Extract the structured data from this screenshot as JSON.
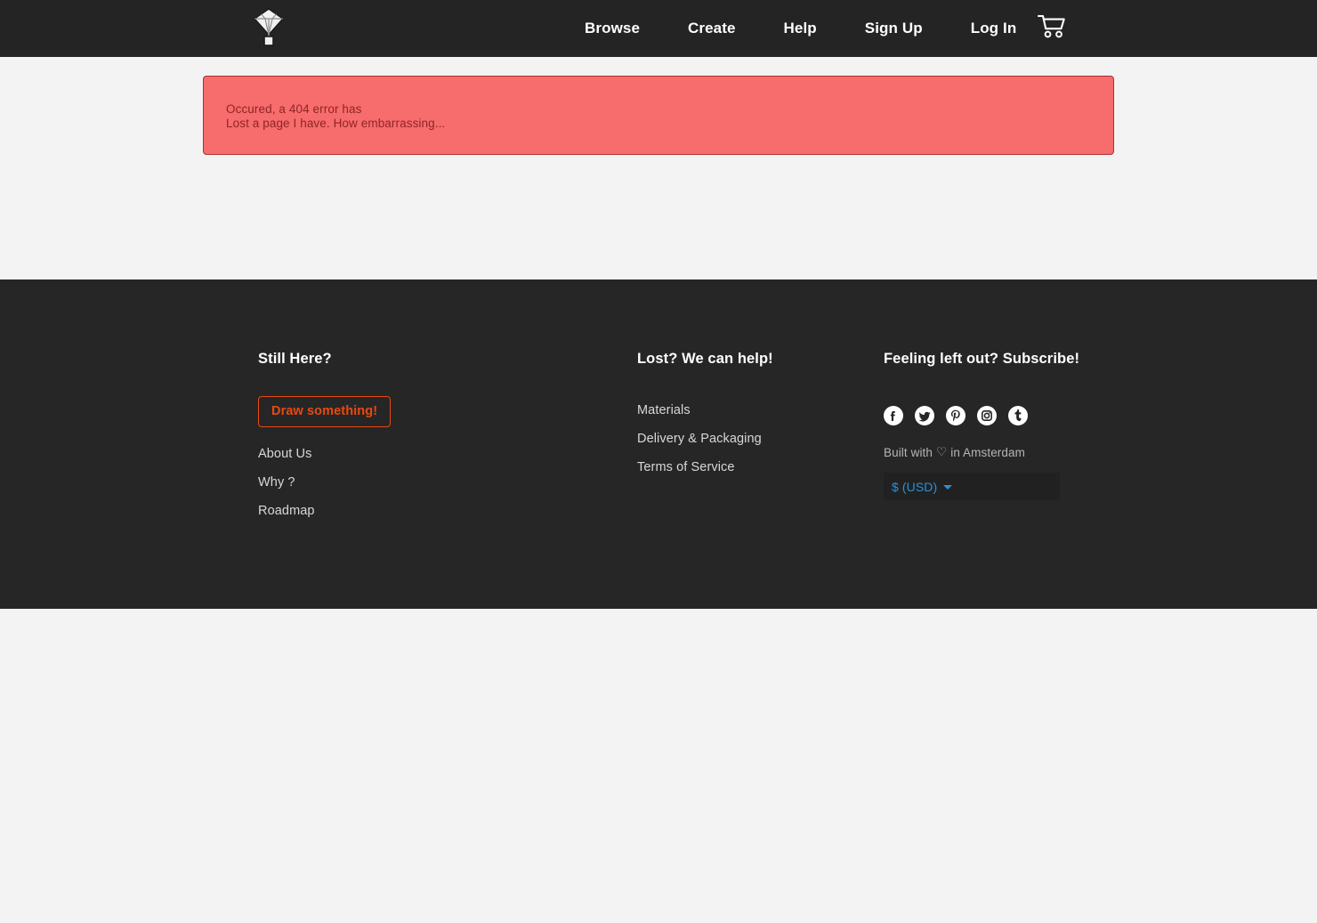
{
  "theme": {
    "page_bg": "#f3f3f3",
    "navbar_bg": "#242424",
    "footer_bg": "#262626",
    "alert_bg": "#f76c6c",
    "alert_border": "#a83232",
    "alert_text": "#8f2525",
    "accent_orange": "#e8490f",
    "link_blue": "#2e90d8"
  },
  "navbar": {
    "logo_icon": "diamond-gem-logo-icon",
    "links": [
      {
        "label": "Browse",
        "name": "nav-link-browse"
      },
      {
        "label": "Create",
        "name": "nav-link-create"
      },
      {
        "label": "Help",
        "name": "nav-link-help"
      },
      {
        "label": "Sign Up",
        "name": "nav-link-sign-up"
      },
      {
        "label": "Log In",
        "name": "nav-link-log-in"
      }
    ],
    "cart_icon": "shopping-cart-icon"
  },
  "alert": {
    "line1": "Occured, a 404 error has",
    "line2": "Lost a page I have. How embarrassing..."
  },
  "footer": {
    "col1": {
      "heading": "Still Here?",
      "button": "Draw something!",
      "links": [
        {
          "label": "About Us"
        },
        {
          "label": "Why ?"
        },
        {
          "label": "Roadmap"
        }
      ]
    },
    "col2": {
      "heading": "Lost? We can help!",
      "links": [
        {
          "label": "Materials"
        },
        {
          "label": "Delivery & Packaging"
        },
        {
          "label": "Terms of Service"
        }
      ]
    },
    "col3": {
      "heading": "Feeling left out? Subscribe!",
      "socials": [
        {
          "name": "facebook-icon",
          "label": "Facebook"
        },
        {
          "name": "twitter-icon",
          "label": "Twitter"
        },
        {
          "name": "pinterest-icon",
          "label": "Pinterest"
        },
        {
          "name": "instagram-icon",
          "label": "Instagram"
        },
        {
          "name": "tumblr-icon",
          "label": "Tumblr"
        }
      ],
      "built_prefix": "Built with",
      "built_heart": "♡",
      "built_suffix": "in Amsterdam",
      "currency": "$ (USD)"
    }
  }
}
